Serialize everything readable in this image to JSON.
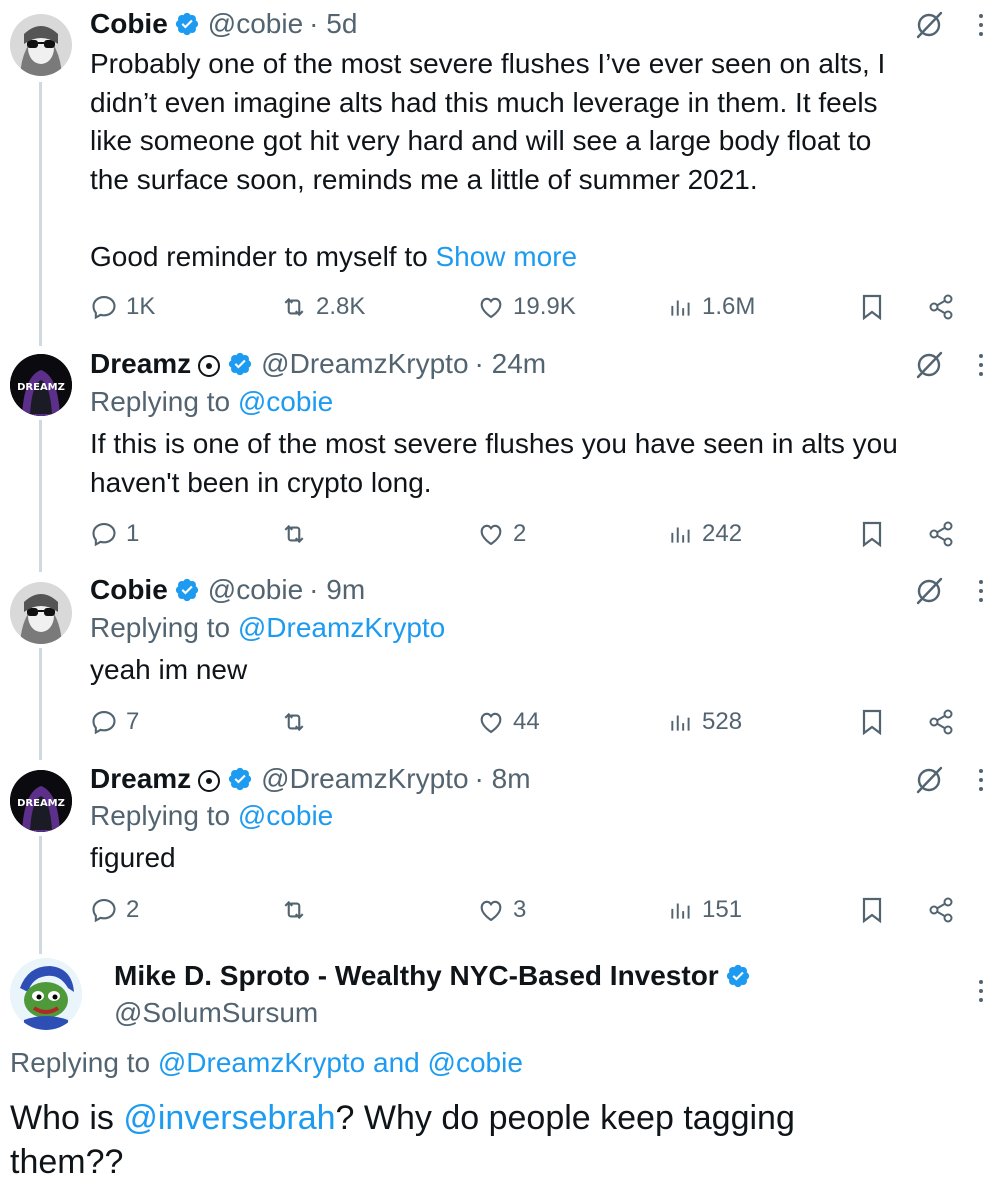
{
  "tweets": [
    {
      "author": "Cobie",
      "handle": "@cobie",
      "time": "· 5d",
      "text_lines": [
        "Probably one of the most severe flushes I’ve ever seen on alts, I",
        "didn’t even imagine alts had this much leverage in them. It feels",
        "like someone got hit very hard and will see a large body float to",
        "the surface soon, reminds me a little of summer 2021."
      ],
      "text_last": "Good reminder to myself to ",
      "show_more": "Show more",
      "replies": "1K",
      "reposts": "2.8K",
      "likes": "19.9K",
      "views": "1.6M"
    },
    {
      "author": "Dreamz",
      "handle": "@DreamzKrypto",
      "time": "· 24m",
      "replying_prefix": "Replying to ",
      "replying_to": "@cobie",
      "text_lines": [
        "If this is one of the most severe flushes you have seen in alts you",
        "haven't been in crypto long."
      ],
      "replies": "1",
      "reposts": "",
      "likes": "2",
      "views": "242",
      "avatar_text": "DREAMZ"
    },
    {
      "author": "Cobie",
      "handle": "@cobie",
      "time": "· 9m",
      "replying_prefix": "Replying to ",
      "replying_to": "@DreamzKrypto",
      "text_lines": [
        "yeah im new"
      ],
      "replies": "7",
      "reposts": "",
      "likes": "44",
      "views": "528"
    },
    {
      "author": "Dreamz",
      "handle": "@DreamzKrypto",
      "time": "· 8m",
      "replying_prefix": "Replying to ",
      "replying_to": "@cobie",
      "text_lines": [
        "figured"
      ],
      "replies": "2",
      "reposts": "",
      "likes": "3",
      "views": "151",
      "avatar_text": "DREAMZ"
    }
  ],
  "main_tweet": {
    "author": "Mike D. Sproto - Wealthy NYC-Based Investor",
    "handle": "@SolumSursum",
    "replying_prefix": "Replying to ",
    "replying_to_1": "@DreamzKrypto",
    "and_word": " and ",
    "replying_to_2": "@cobie",
    "text_before": "Who is ",
    "mention": "@inversebrah",
    "text_after": "? Why do people keep tagging",
    "text_line2": "them??"
  },
  "colors": {
    "link": "#1d9bf0",
    "muted": "#536471",
    "verified": "#1d9bf0",
    "thread_line": "#cfd9de"
  }
}
